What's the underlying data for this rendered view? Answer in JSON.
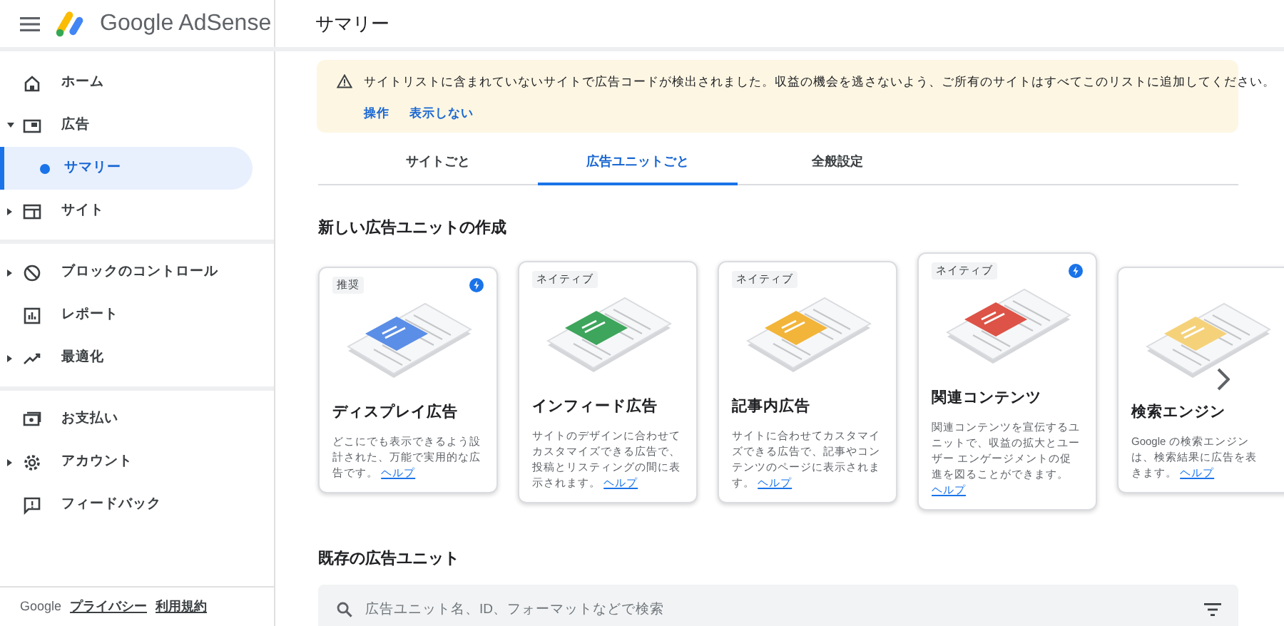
{
  "header": {
    "logo_text": "Google AdSense",
    "title": "サマリー"
  },
  "sidebar": {
    "sections": [
      [
        {
          "label": "ホーム",
          "selected": false
        },
        {
          "label": "広告",
          "selected": false,
          "expanded": true,
          "children": [
            {
              "label": "サマリー",
              "selected": true
            }
          ]
        },
        {
          "label": "サイト",
          "selected": false,
          "expanded": false
        }
      ],
      [
        {
          "label": "ブロックのコントロール",
          "selected": false,
          "expanded": false
        },
        {
          "label": "レポート",
          "selected": false
        },
        {
          "label": "最適化",
          "selected": false,
          "expanded": false
        }
      ],
      [
        {
          "label": "お支払い",
          "selected": false
        },
        {
          "label": "アカウント",
          "selected": false,
          "expanded": false
        },
        {
          "label": "フィードバック",
          "selected": false
        }
      ]
    ],
    "footer": {
      "brand": "Google",
      "links": [
        "プライバシー",
        "利用規約"
      ]
    }
  },
  "banner": {
    "message": "サイトリストに含まれていないサイトで広告コードが検出されました。収益の機会を逃さないよう、ご所有のサイトはすべてこのリストに追加してください。",
    "actions": [
      "操作",
      "表示しない"
    ]
  },
  "tabs": [
    {
      "label": "サイトごと",
      "selected": false
    },
    {
      "label": "広告ユニットごと",
      "selected": true
    },
    {
      "label": "全般設定",
      "selected": false
    }
  ],
  "create_section": {
    "title": "新しい広告ユニットの作成",
    "cards": [
      {
        "kind": "full",
        "tag": "推奨",
        "bolt": true,
        "color": "#5b8ee6",
        "title": "ディスプレイ広告",
        "description": "どこにでも表示できるよう設計された、万能で実用的な広告です。",
        "help": "ヘルプ"
      },
      {
        "kind": "full",
        "tag": "ネイティブ",
        "bolt": false,
        "color": "#3ea55c",
        "title": "インフィード広告",
        "description": "サイトのデザインに合わせてカスタマイズできる広告で、投稿とリスティングの間に表示されます。",
        "help": "ヘルプ"
      },
      {
        "kind": "full",
        "tag": "ネイティブ",
        "bolt": false,
        "color": "#f2b53a",
        "title": "記事内広告",
        "description": "サイトに合わせてカスタマイズできる広告で、記事やコンテンツのページに表示されます。",
        "help": "ヘルプ"
      },
      {
        "kind": "full",
        "tag": "ネイティブ",
        "bolt": true,
        "color": "#dd5347",
        "title": "関連コンテンツ",
        "description": "関連コンテンツを宣伝するユニットで、収益の拡大とユーザー エンゲージメントの促進を図ることができます。",
        "help": "ヘルプ"
      },
      {
        "kind": "cut",
        "bolt": false,
        "color": "#f5d27a",
        "title": "検索エンジン",
        "description_lines": [
          "Google の検索エンジン",
          "は、検索結果に広告を表",
          "きます。"
        ],
        "help": "ヘルプ"
      }
    ]
  },
  "existing_section": {
    "title": "既存の広告ユニット",
    "search": {
      "placeholder": "広告ユニット名、ID、フォーマットなどで検索"
    }
  }
}
